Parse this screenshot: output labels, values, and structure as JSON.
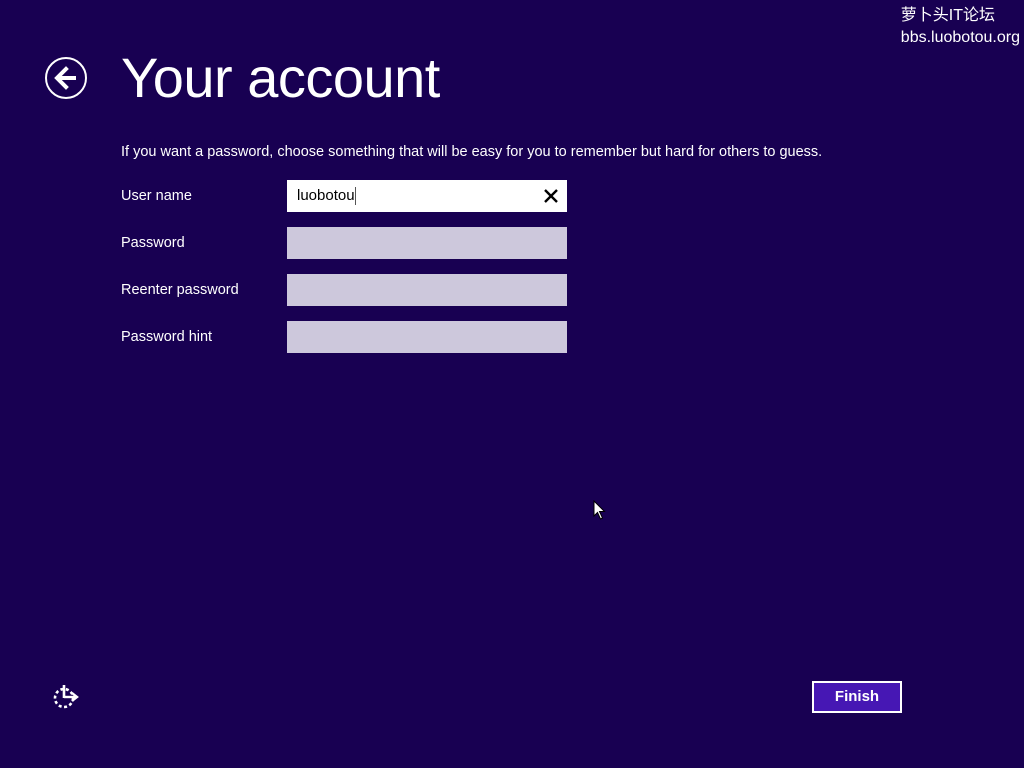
{
  "watermark": {
    "line1": "萝卜头IT论坛",
    "line2": "bbs.luobotou.org"
  },
  "header": {
    "back_icon": "arrow-left-circle-icon",
    "title": "Your account"
  },
  "instructions": "If you want a password, choose something that will be easy for you to remember but hard for others to guess.",
  "form": {
    "fields": [
      {
        "label": "User name",
        "value": "luobotou",
        "focused": true,
        "clear_icon": "close-x-icon"
      },
      {
        "label": "Password",
        "value": ""
      },
      {
        "label": "Reenter password",
        "value": ""
      },
      {
        "label": "Password hint",
        "value": ""
      }
    ]
  },
  "footer": {
    "ease_of_access_icon": "ease-of-access-icon",
    "finish_label": "Finish"
  },
  "colors": {
    "background": "#180052",
    "button_accent": "#4617b4",
    "inactive_input": "#cdc8dc"
  }
}
